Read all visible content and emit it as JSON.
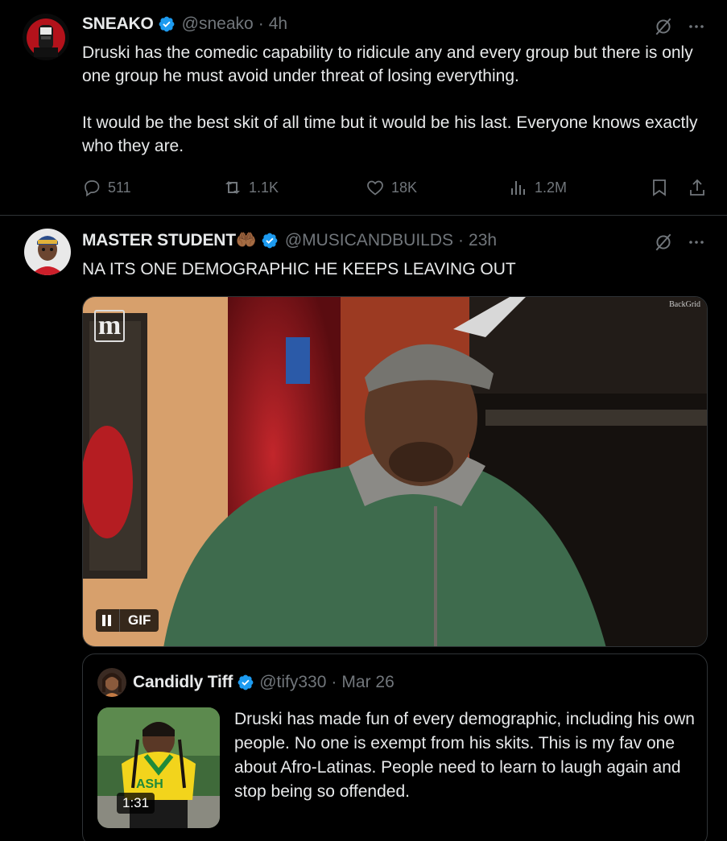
{
  "tweet1": {
    "name": "SNEAKO",
    "handle": "@sneako",
    "dot": "·",
    "time": "4h",
    "paragraphs": [
      "Druski has the comedic capability to ridicule any and every group but there is only one group he must avoid under threat of losing everything.",
      "It would be the best skit of all time but it would be his last. Everyone knows exactly who they are."
    ],
    "replies": "511",
    "reposts": "1.1K",
    "likes": "18K",
    "views": "1.2M"
  },
  "tweet2": {
    "name": "MASTER STUDENT🤲🏾",
    "handle": "@MUSICANDBUILDS",
    "dot": "·",
    "time": "23h",
    "text": "NA ITS ONE DEMOGRAPHIC HE KEEPS LEAVING OUT",
    "media": {
      "badge_label": "GIF",
      "watermark": "BackGrid",
      "logo_letter": "m"
    },
    "quote": {
      "name": "Candidly Tiff",
      "handle": "@tify330",
      "dot": "·",
      "date": "Mar 26",
      "text": "Druski has made fun of every demographic, including his own people. No one is exempt from his skits. This is my fav one about Afro-Latinas. People need to learn to laugh again and stop being so offended.",
      "video_duration": "1:31"
    }
  },
  "colors": {
    "background": "#000000",
    "text": "#e7e9ea",
    "muted": "#71767b",
    "verified": "#1d9bf0",
    "border": "#2f3336"
  },
  "icons": [
    "grok-icon",
    "more-icon",
    "reply-icon",
    "repost-icon",
    "like-icon",
    "views-icon",
    "bookmark-icon",
    "share-icon",
    "verified-badge-icon"
  ]
}
